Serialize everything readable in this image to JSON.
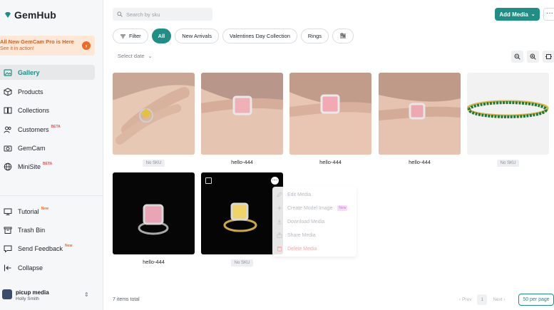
{
  "app": {
    "name": "GemHub"
  },
  "promo": {
    "title": "All New GemCam Pro is Here",
    "subtitle": "See it in action!"
  },
  "sidebar": {
    "items": [
      {
        "label": "Gallery",
        "badge": ""
      },
      {
        "label": "Products",
        "badge": ""
      },
      {
        "label": "Collections",
        "badge": ""
      },
      {
        "label": "Customers",
        "badge": "BETA"
      },
      {
        "label": "GemCam",
        "badge": ""
      },
      {
        "label": "MiniSite",
        "badge": "BETA"
      },
      {
        "label": "Tutorial",
        "badge": "New"
      },
      {
        "label": "Trash Bin",
        "badge": ""
      },
      {
        "label": "Send Feedback",
        "badge": "New"
      },
      {
        "label": "Collapse",
        "badge": ""
      }
    ]
  },
  "account": {
    "name": "picup media",
    "user": "Holly Smith"
  },
  "search": {
    "placeholder": "Search by sku"
  },
  "toolbar": {
    "add_media": "Add Media",
    "filter": "Filter"
  },
  "filters": [
    "All",
    "New Arrivals",
    "Valentines Day Collection",
    "Rings"
  ],
  "date_select": "Select date",
  "cards": [
    {
      "caption": "No SKU"
    },
    {
      "caption": "hello-444"
    },
    {
      "caption": "hello-444"
    },
    {
      "caption": "hello-444"
    },
    {
      "caption": "No SKU"
    },
    {
      "caption": "hello-444"
    },
    {
      "caption": "No SKU"
    }
  ],
  "context_menu": {
    "items": [
      "Edit Media",
      "Create Model Image",
      "Download Media",
      "Share Media",
      "Delete Media"
    ],
    "new_tag": "New"
  },
  "footer": {
    "total": "7 items total",
    "prev": "‹ Prev",
    "page": "1",
    "next": "Next ›",
    "per_page": "50 per page"
  },
  "colors": {
    "accent": "#1f8f86",
    "promo": "#f06a26",
    "danger": "#e8505b"
  }
}
